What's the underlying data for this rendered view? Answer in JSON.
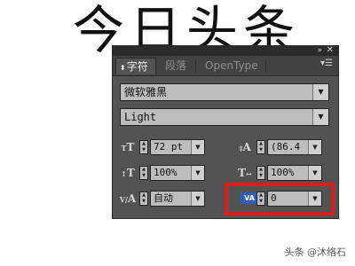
{
  "canvas": {
    "headline": "今日头条"
  },
  "watermark": "头条 @沐络石",
  "panel": {
    "collapse_icon": "double-chevron-right-icon",
    "close_icon": "close-icon",
    "tabs": [
      {
        "label": "字符",
        "active": true
      },
      {
        "label": "段落",
        "active": false
      },
      {
        "label": "OpenType",
        "active": false
      }
    ],
    "menu_icon": "panel-menu-icon",
    "font_family": "微软雅黑",
    "font_style": "Light",
    "controls": {
      "font_size": "72 pt",
      "leading": "(86.4",
      "vertical_scale": "100%",
      "horizontal_scale": "100%",
      "kerning": "自动",
      "tracking": "0"
    }
  },
  "colors": {
    "panel_bg": "#535353",
    "highlight": "#e01b1b"
  }
}
